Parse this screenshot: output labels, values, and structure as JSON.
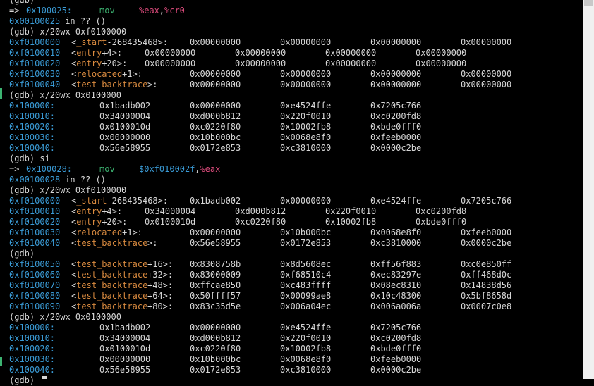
{
  "terminal": {
    "lines": [
      {
        "kind": "prompt",
        "text": "(gdb)"
      },
      {
        "kind": "exec",
        "arrow": "=>",
        "addr": "0x100025:",
        "ins": "mov",
        "op1": "%eax",
        "op2": "%cr0"
      },
      {
        "kind": "where",
        "addr": "0x00100025",
        "rest": "in ?? ()"
      },
      {
        "kind": "prompt",
        "text": "(gdb) x/20wx 0xf0100000"
      },
      {
        "kind": "sym",
        "addr": "0xf0100000",
        "sym": "<_start-268435468>:",
        "vals": [
          "0x00000000",
          "0x00000000",
          "0x00000000",
          "0x00000000"
        ]
      },
      {
        "kind": "sym",
        "addr": "0xf0100010",
        "sym": "<entry+4>:",
        "vals": [
          "0x00000000",
          "0x00000000",
          "0x00000000",
          "0x00000000"
        ]
      },
      {
        "kind": "sym",
        "addr": "0xf0100020",
        "sym": "<entry+20>:",
        "vals": [
          "0x00000000",
          "0x00000000",
          "0x00000000",
          "0x00000000"
        ]
      },
      {
        "kind": "sym",
        "addr": "0xf0100030",
        "sym": "<relocated+1>:",
        "vals": [
          "0x00000000",
          "0x00000000",
          "0x00000000",
          "0x00000000"
        ]
      },
      {
        "kind": "sym",
        "addr": "0xf0100040",
        "sym": "<test_backtrace>:",
        "vals": [
          "0x00000000",
          "0x00000000",
          "0x00000000",
          "0x00000000"
        ]
      },
      {
        "kind": "prompt",
        "text": "(gdb) x/20wx 0x0100000"
      },
      {
        "kind": "plainaddr",
        "addr": "0x100000:",
        "vals": [
          "0x1badb002",
          "0x00000000",
          "0xe4524ffe",
          "0x7205c766"
        ]
      },
      {
        "kind": "plainaddr",
        "addr": "0x100010:",
        "vals": [
          "0x34000004",
          "0xd000b812",
          "0x220f0010",
          "0xc0200fd8"
        ]
      },
      {
        "kind": "plainaddr",
        "addr": "0x100020:",
        "vals": [
          "0x0100010d",
          "0xc0220f80",
          "0x10002fb8",
          "0xbde0fff0"
        ]
      },
      {
        "kind": "plainaddr",
        "addr": "0x100030:",
        "vals": [
          "0x00000000",
          "0x10b000bc",
          "0x0068e8f0",
          "0xfeeb0000"
        ]
      },
      {
        "kind": "plainaddr",
        "addr": "0x100040:",
        "vals": [
          "0x56e58955",
          "0x0172e853",
          "0xc3810000",
          "0x0000c2be"
        ]
      },
      {
        "kind": "prompt",
        "text": "(gdb) si"
      },
      {
        "kind": "exec2",
        "arrow": "=>",
        "addr": "0x100028:",
        "ins": "mov",
        "op1": "$0xf010002f",
        "op2": "%eax"
      },
      {
        "kind": "where",
        "addr": "0x00100028",
        "rest": "in ?? ()"
      },
      {
        "kind": "prompt",
        "text": "(gdb) x/20wx 0xf0100000"
      },
      {
        "kind": "sym",
        "addr": "0xf0100000",
        "sym": "<_start-268435468>:",
        "vals": [
          "0x1badb002",
          "0x00000000",
          "0xe4524ffe",
          "0x7205c766"
        ]
      },
      {
        "kind": "sym",
        "addr": "0xf0100010",
        "sym": "<entry+4>:",
        "vals": [
          "0x34000004",
          "0xd000b812",
          "0x220f0010",
          "0xc0200fd8"
        ]
      },
      {
        "kind": "sym",
        "addr": "0xf0100020",
        "sym": "<entry+20>:",
        "vals": [
          "0x0100010d",
          "0xc0220f80",
          "0x10002fb8",
          "0xbde0fff0"
        ]
      },
      {
        "kind": "sym",
        "addr": "0xf0100030",
        "sym": "<relocated+1>:",
        "vals": [
          "0x00000000",
          "0x10b000bc",
          "0x0068e8f0",
          "0xfeeb0000"
        ]
      },
      {
        "kind": "sym",
        "addr": "0xf0100040",
        "sym": "<test_backtrace>:",
        "vals": [
          "0x56e58955",
          "0x0172e853",
          "0xc3810000",
          "0x0000c2be"
        ]
      },
      {
        "kind": "prompt",
        "text": "(gdb)"
      },
      {
        "kind": "sym",
        "addr": "0xf0100050",
        "sym": "<test_backtrace+16>:",
        "vals": [
          "0x8308758b",
          "0x8d5608ec",
          "0xff56f883",
          "0xc0e850ff"
        ]
      },
      {
        "kind": "sym",
        "addr": "0xf0100060",
        "sym": "<test_backtrace+32>:",
        "vals": [
          "0x83000009",
          "0xf68510c4",
          "0xec83297e",
          "0xff468d0c"
        ]
      },
      {
        "kind": "sym",
        "addr": "0xf0100070",
        "sym": "<test_backtrace+48>:",
        "vals": [
          "0xffcae850",
          "0xc483ffff",
          "0x08ec8310",
          "0x14838d56"
        ]
      },
      {
        "kind": "sym",
        "addr": "0xf0100080",
        "sym": "<test_backtrace+64>:",
        "vals": [
          "0x50ffff57",
          "0x00099ae8",
          "0x10c48300",
          "0x5bf8658d"
        ]
      },
      {
        "kind": "sym",
        "addr": "0xf0100090",
        "sym": "<test_backtrace+80>:",
        "vals": [
          "0x83c35d5e",
          "0x006a04ec",
          "0x006a006a",
          "0x0007c0e8"
        ]
      },
      {
        "kind": "prompt",
        "text": "(gdb) x/20wx 0x0100000"
      },
      {
        "kind": "plainaddr",
        "addr": "0x100000:",
        "vals": [
          "0x1badb002",
          "0x00000000",
          "0xe4524ffe",
          "0x7205c766"
        ]
      },
      {
        "kind": "plainaddr",
        "addr": "0x100010:",
        "vals": [
          "0x34000004",
          "0xd000b812",
          "0x220f0010",
          "0xc0200fd8"
        ]
      },
      {
        "kind": "plainaddr",
        "addr": "0x100020:",
        "vals": [
          "0x0100010d",
          "0xc0220f80",
          "0x10002fb8",
          "0xbde0fff0"
        ]
      },
      {
        "kind": "plainaddr",
        "addr": "0x100030:",
        "vals": [
          "0x00000000",
          "0x10b000bc",
          "0x0068e8f0",
          "0xfeeb0000"
        ]
      },
      {
        "kind": "plainaddr",
        "addr": "0x100040:",
        "vals": [
          "0x56e58955",
          "0x0172e853",
          "0xc3810000",
          "0x0000c2be"
        ]
      },
      {
        "kind": "prompt",
        "text": "(gdb)"
      }
    ]
  },
  "colors": {
    "background": "#000000",
    "text": "#d6d6d6",
    "address": "#3a9bd6",
    "symbol": "#d98a3f",
    "instruction": "#3cb371",
    "register": "#d94a7a"
  }
}
